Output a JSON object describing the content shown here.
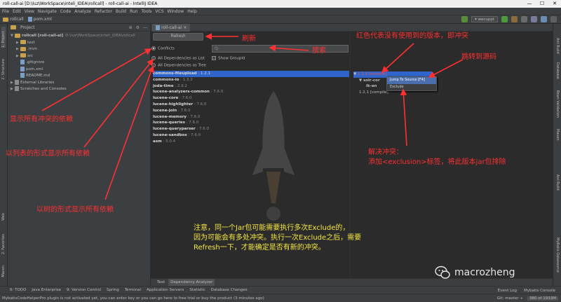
{
  "window": {
    "title": "roll-call-ai [D:\\luz\\WorkSpace\\inteli_IDEA\\rollcall] - roll-call-ai - IntelliJ IDEA",
    "controls": [
      "—",
      "☐",
      "✕"
    ]
  },
  "menu": [
    "File",
    "Edit",
    "View",
    "Navigate",
    "Code",
    "Analyze",
    "Refactor",
    "Build",
    "Run",
    "Tools",
    "VCS",
    "Window",
    "Help"
  ],
  "nav": {
    "crumbs": [
      "rollcall",
      "pom.xml"
    ],
    "run_config": "wecuppt"
  },
  "left_stripe": [
    "1: Project",
    "2: Structure",
    "Web",
    "2: Favorites",
    "Maven"
  ],
  "right_stripe": [
    "Ant Build",
    "Database",
    "Bean Validation",
    "Maven",
    "Ant Build",
    "MyBatis Datasource"
  ],
  "project": {
    "header": "Project",
    "tree": [
      {
        "label": "rollcall [roll-call-ai]",
        "path": "D:\\luz\\WorkSpace\\inteli_IDEA\\rollcall",
        "indent": 0,
        "arrow": "▼",
        "icon": "folder"
      },
      {
        "label": "test",
        "indent": 1,
        "arrow": "▶",
        "icon": "folder"
      },
      {
        "label": ".mvn",
        "indent": 1,
        "arrow": "▶",
        "icon": "folder"
      },
      {
        "label": "src",
        "indent": 1,
        "arrow": "▶",
        "icon": "folder"
      },
      {
        "label": ".gitignore",
        "indent": 1,
        "arrow": "",
        "icon": "file"
      },
      {
        "label": "pom.xml",
        "indent": 1,
        "arrow": "",
        "icon": "file"
      },
      {
        "label": "README.md",
        "indent": 1,
        "arrow": "",
        "icon": "file"
      },
      {
        "label": "External Libraries",
        "indent": 0,
        "arrow": "▶",
        "icon": "lib"
      },
      {
        "label": "Scratches and Consoles",
        "indent": 0,
        "arrow": "▶",
        "icon": "lib"
      }
    ]
  },
  "editor": {
    "tab": "roll-call-ai"
  },
  "analyzer": {
    "refresh_label": "Refresh",
    "mode_conflicts": "Conflicts",
    "mode_list": "All Dependencies as List",
    "mode_tree": "All Dependencies as Tree",
    "search_placeholder": "Q-",
    "show_groupid": "Show GroupId",
    "dependencies": [
      {
        "name": "commons-fileupload",
        "version": " : 1.2.1",
        "selected": true
      },
      {
        "name": "commons-io",
        "version": " : 1.3.2",
        "selected": false
      },
      {
        "name": "joda-time",
        "version": " : 2.9.2",
        "selected": false
      },
      {
        "name": "lucene-analyzers-common",
        "version": " : 7.6.0",
        "selected": false
      },
      {
        "name": "lucene-core",
        "version": " : 7.6.0",
        "selected": false
      },
      {
        "name": "lucene-highlighter",
        "version": " : 7.6.0",
        "selected": false
      },
      {
        "name": "lucene-join",
        "version": " : 7.6.0",
        "selected": false
      },
      {
        "name": "lucene-memory",
        "version": " : 7.6.0",
        "selected": false
      },
      {
        "name": "lucene-queries",
        "version": " : 7.6.0",
        "selected": false
      },
      {
        "name": "lucene-queryparser",
        "version": " : 7.6.0",
        "selected": false
      },
      {
        "name": "lucene-sandbox",
        "version": " : 7.6.0",
        "selected": false
      },
      {
        "name": "asm",
        "version": " : 5.0.4",
        "selected": false
      }
    ],
    "right_tree": {
      "root": "1.3.3 [compile]",
      "child": "solr-cor",
      "grandchild": "ik-an",
      "leaf": "1.2.1 [compile]"
    },
    "context_menu": [
      "Jump To Source [F4]",
      "Exclude"
    ],
    "bottom_tabs": [
      "Text",
      "Dependency Analyzer"
    ]
  },
  "toolwindows": {
    "left": [
      "6: TODO",
      "Java Enterprise",
      "9: Version Control",
      "Spring",
      "Terminal",
      "Application Servers",
      "Statistic",
      "Database Changes"
    ],
    "right": [
      "Event Log",
      "Mybatis Console"
    ]
  },
  "status": {
    "message": "MybatisCodeHelperPro plugin is not activated yet, you can enter key or you can go here to free trial or buy the product (3 minutes ago)",
    "git": "Git: master ÷",
    "memory": "380 of 1933M"
  },
  "annotations": {
    "refresh": "刷新",
    "search": "搜索",
    "red_means": "红色代表没有使用到的版本，即冲突",
    "jump": "跳转到源码",
    "conflicts": "显示所有冲突的依赖",
    "list": "以列表的形式显示所有依赖",
    "tree": "以树的形式显示所有依赖",
    "resolve_1": "解决冲突：",
    "resolve_2": "添加<exclusion>标签，将此版本jar包排除",
    "note_1": "注意，同一个Jar包可能需要执行多次Exclude的，",
    "note_2": "因为可能会有多处冲突。执行一次Exclude之后，需要",
    "note_3": "Refresh一下，才能确定是否有新的冲突。",
    "watermark": "macrozheng"
  },
  "colors": {
    "annotation_red": "#ff3030",
    "annotation_yellow": "#f5e642",
    "selection": "#2f65ca",
    "conflict_red": "#e05555"
  }
}
